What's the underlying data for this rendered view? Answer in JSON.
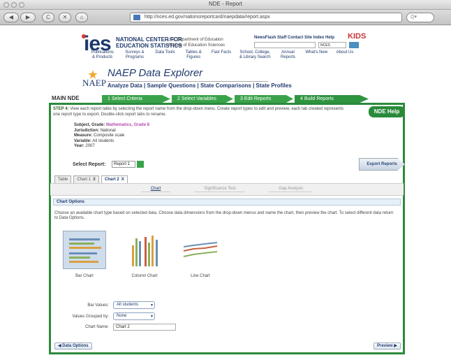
{
  "browser": {
    "window_title": "NDE - Report",
    "url": "http://nces.ed.gov/nationsreportcard/naepdata/report.aspx",
    "search_placeholder": "Q▾",
    "back": "◀",
    "forward": "▶",
    "reload": "C",
    "stop": "✕",
    "home": "⌂"
  },
  "header": {
    "logo": "ies",
    "nces_line1": "NATIONAL CENTER FOR",
    "nces_line2": "EDUCATION STATISTICS",
    "dept_line1": "U.S. Department of Education",
    "dept_line2": "Institute of Education Sciences",
    "top_links": "NewsFlash  Staff  Contact  Site Index  Help",
    "kids": "KIDS",
    "search_scope": "NCES",
    "nav": [
      "Publications & Products",
      "Surveys & Programs",
      "Data Tools",
      "Tables & Figures",
      "Fast Facts",
      "School, College, & Library Search",
      "Annual Reports",
      "What's New",
      "About Us"
    ]
  },
  "explorer": {
    "naep": "NAEP",
    "title": "NAEP Data Explorer",
    "links": "Analyze Data | Sample Questions | State Comparisons | State Profiles"
  },
  "steps": {
    "main": "MAIN NDE",
    "items": [
      "1  Select Criteria",
      "2  Select Variables",
      "3  Edit Reports",
      "4  Build Reports"
    ]
  },
  "step4": {
    "label": "STEP 4:",
    "text": "View each report table by selecting the report name from the drop-down menu. Create report types to edit and preview, each tab created represents one report type to export. Double-click report tabs to rename.",
    "help": "NDE Help",
    "subject_label": "Subject, Grade:",
    "subject_value": "Mathematics, Grade 8",
    "jurisdiction_label": "Jurisdiction:",
    "jurisdiction_value": "National",
    "measure_label": "Measure:",
    "measure_value": "Composite scale",
    "variable_label": "Variable:",
    "variable_value": "All students",
    "year_label": "Year:",
    "year_value": "2007"
  },
  "report": {
    "select_label": "Select Report:",
    "selected": "Report 1",
    "export": "Export Reports",
    "tabs": [
      "Table",
      "Chart 1",
      "Chart 2"
    ],
    "tab_close": "X",
    "subtabs": [
      "Chart",
      "Significance Test",
      "Gap Analysis"
    ]
  },
  "options": {
    "bar_title": "Chart Options",
    "instructions": "Choose an available chart type based on selected data. Choose data dimensions from the drop-down menus and name the chart, then preview the chart. To select different data return to Data Options.",
    "charts": [
      "Bar Chart",
      "Column Chart",
      "Line Chart"
    ],
    "bar_values_label": "Bar Values:",
    "bar_values": "All students",
    "grouped_label": "Values Grouped by:",
    "grouped": "None",
    "name_label": "Chart Name:",
    "name": "Chart 2",
    "data_options": "◀ Data Options",
    "preview": "Preview ▶"
  },
  "colors": {
    "green": "#2c8a3c",
    "navy": "#1f3a6e"
  }
}
